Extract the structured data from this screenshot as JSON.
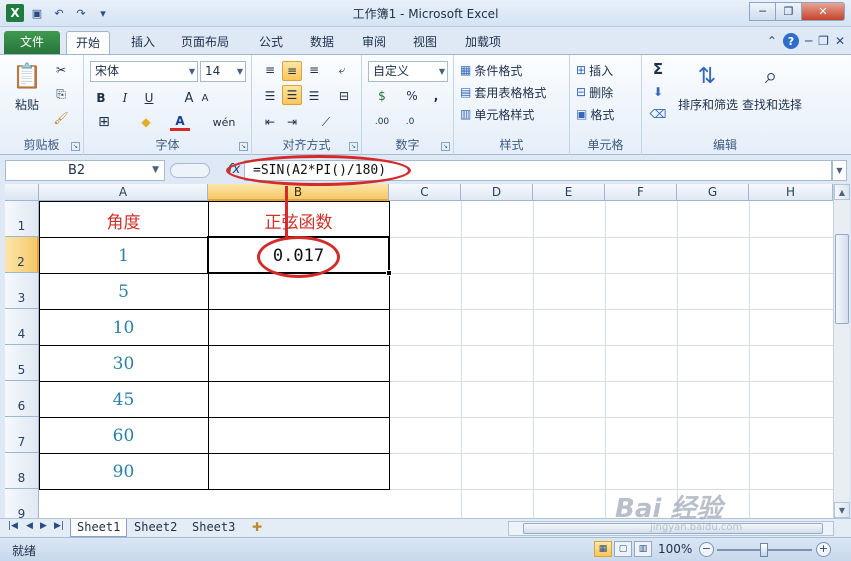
{
  "window": {
    "title": "工作簿1 - Microsoft Excel",
    "app_logo": "X"
  },
  "ribbon_tabs": [
    "文件",
    "开始",
    "插入",
    "页面布局",
    "公式",
    "数据",
    "审阅",
    "视图",
    "加载项"
  ],
  "ribbon": {
    "clipboard": {
      "label": "剪贴板",
      "paste_label": "粘贴"
    },
    "font": {
      "label": "字体",
      "font_name": "宋体",
      "font_size": "14",
      "bold": "B",
      "italic": "I",
      "underline": "U",
      "grow": "A",
      "shrink": "A",
      "font_color": "A",
      "phonetic": "wén"
    },
    "alignment": {
      "label": "对齐方式"
    },
    "number": {
      "label": "数字",
      "format": "自定义",
      "percent": "%",
      "comma": ","
    },
    "styles": {
      "label": "样式",
      "conditional": "条件格式",
      "table": "套用表格格式",
      "cell_styles": "单元格样式"
    },
    "cells": {
      "label": "单元格",
      "insert": "插入",
      "delete": "删除",
      "format": "格式"
    },
    "editing": {
      "label": "编辑",
      "sum": "Σ",
      "sort": "排序和筛选",
      "find": "查找和选择"
    }
  },
  "formula_bar": {
    "name_box": "B2",
    "fx": "fx",
    "formula": "=SIN(A2*PI()/180)"
  },
  "columns": [
    "A",
    "B",
    "C",
    "D",
    "E",
    "F",
    "G",
    "H"
  ],
  "rows": [
    "1",
    "2",
    "3",
    "4",
    "5",
    "6",
    "7",
    "8",
    "9"
  ],
  "table": {
    "header_a": "角度",
    "header_b": "正弦函数",
    "angles": [
      "1",
      "5",
      "10",
      "30",
      "45",
      "60",
      "90"
    ],
    "b2_value": "0.017"
  },
  "sheets": [
    "Sheet1",
    "Sheet2",
    "Sheet3"
  ],
  "status": {
    "ready": "就绪",
    "zoom": "100%"
  },
  "watermark": {
    "brand": "Bai 经验",
    "url": "jingyan.baidu.com"
  }
}
